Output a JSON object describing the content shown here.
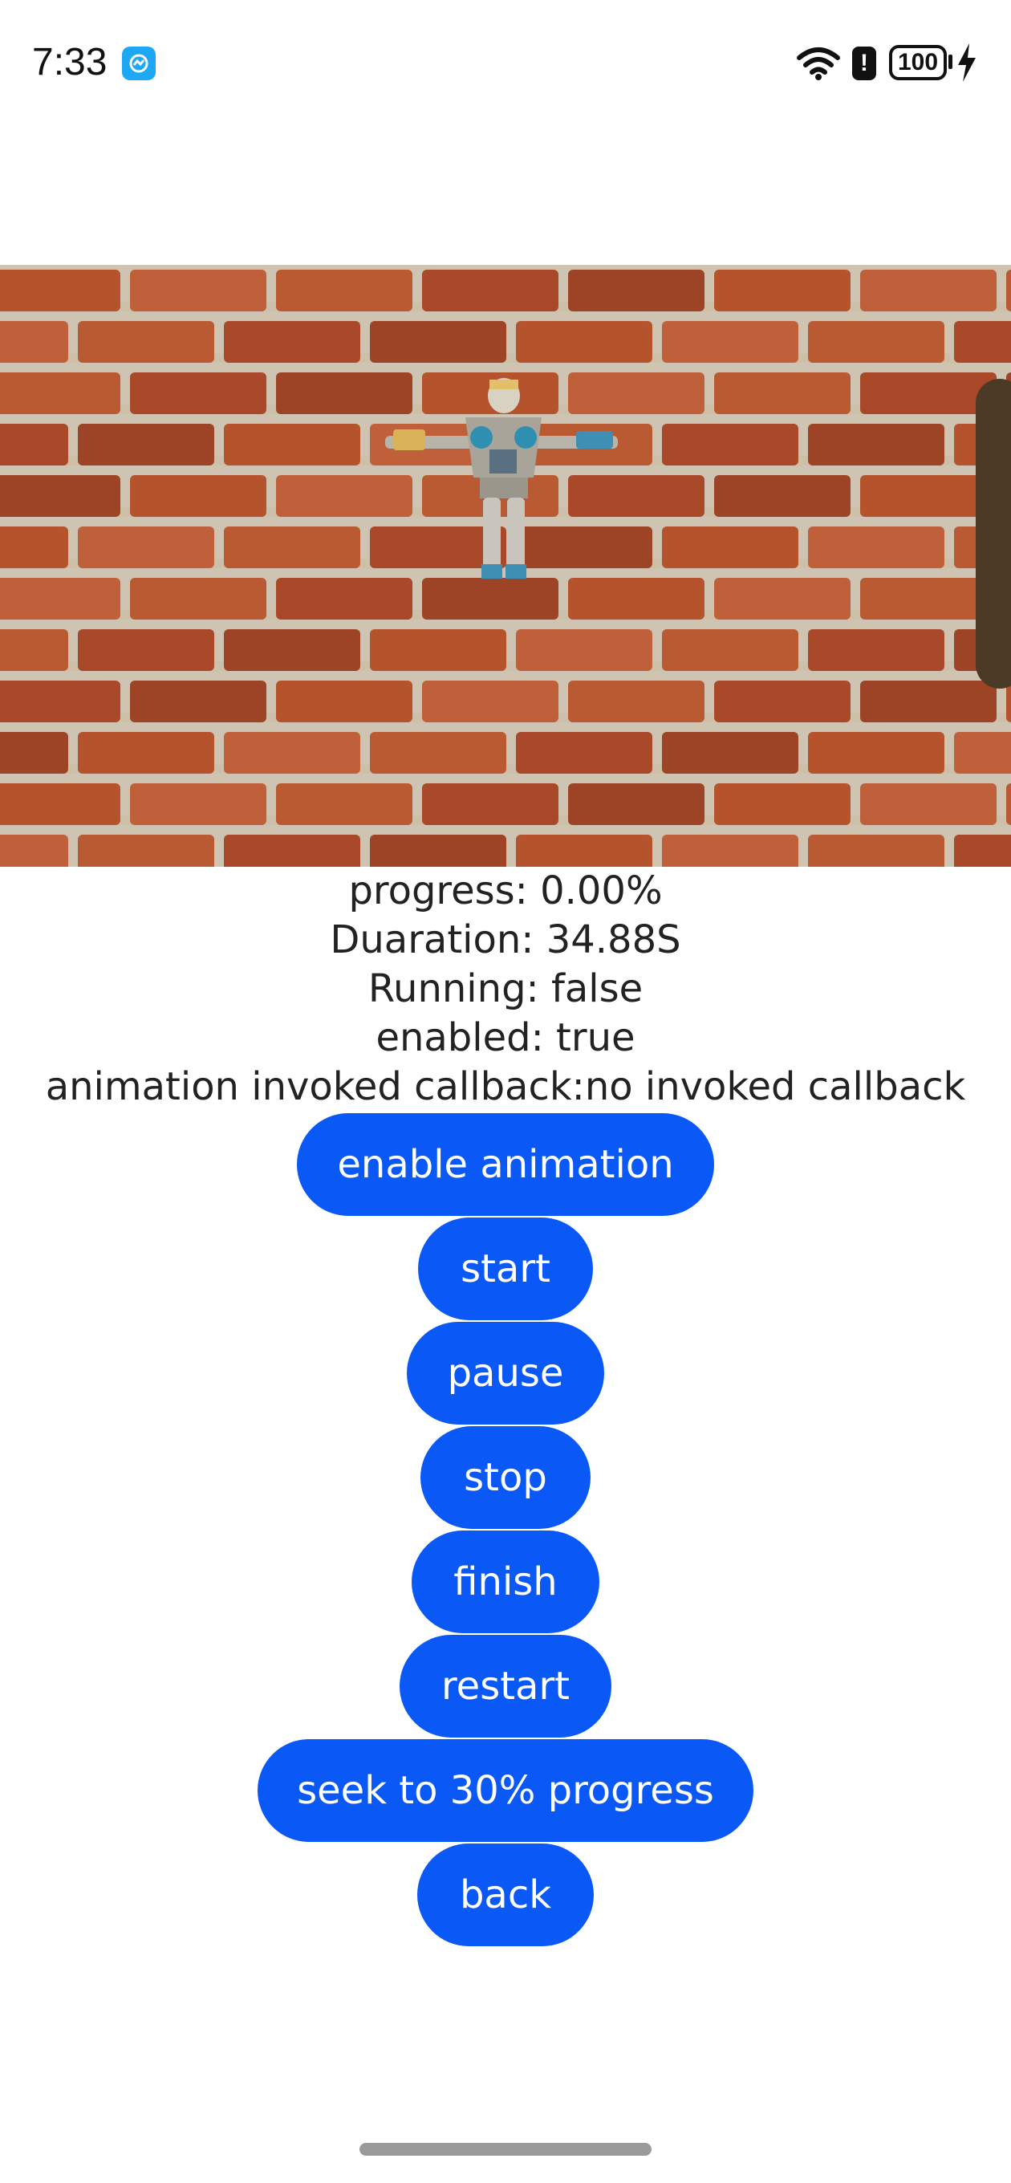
{
  "status_bar": {
    "time": "7:33",
    "battery_level": "100",
    "icons": [
      "app-notification-icon",
      "wifi-icon",
      "alert-icon",
      "battery-icon",
      "charging-icon"
    ]
  },
  "scene": {
    "background": "brick-wall",
    "model": "animated-robot-figure"
  },
  "info": {
    "progress": "progress: 0.00%",
    "duration": "Duaration: 34.88S",
    "running": "Running: false",
    "enabled": "enabled: true",
    "callback": "animation invoked callback:no invoked callback"
  },
  "buttons": {
    "enable_animation": "enable animation",
    "start": "start",
    "pause": "pause",
    "stop": "stop",
    "finish": "finish",
    "restart": "restart",
    "seek": "seek to 30% progress",
    "back": "back"
  },
  "colors": {
    "button_bg": "#0a59f7",
    "button_text": "#ffffff",
    "text": "#222222",
    "brick": "#b5532c",
    "mortar": "#cdbfa8"
  }
}
